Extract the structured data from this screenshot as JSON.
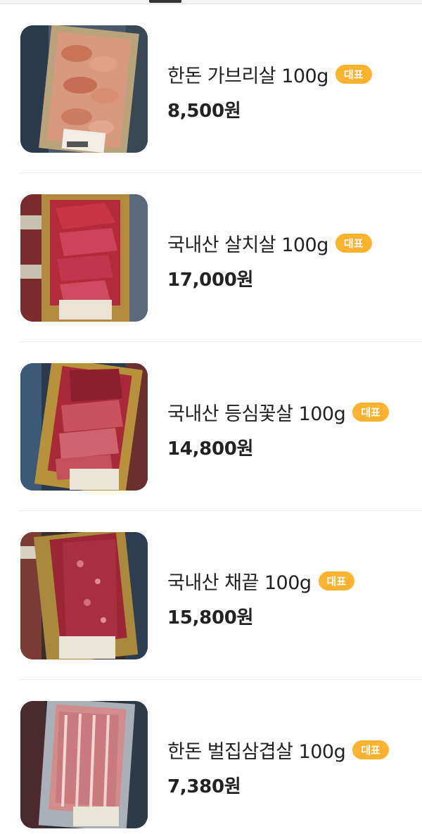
{
  "menu": {
    "items": [
      {
        "name": "한돈 가브리살 100g",
        "badge": "대표",
        "price": "8,500원",
        "image": "pork-jowl-tray-photo"
      },
      {
        "name": "국내산 살치살 100g",
        "badge": "대표",
        "price": "17,000원",
        "image": "beef-chuck-flap-tray-photo"
      },
      {
        "name": "국내산 등심꽃살 100g",
        "badge": "대표",
        "price": "14,800원",
        "image": "beef-sirloin-tray-photo"
      },
      {
        "name": "국내산 채끝 100g",
        "badge": "대표",
        "price": "15,800원",
        "image": "beef-striploin-tray-photo"
      },
      {
        "name": "한돈 벌집삼겹살 100g",
        "badge": "대표",
        "price": "7,380원",
        "image": "honeycomb-pork-belly-tray-photo"
      }
    ]
  },
  "colors": {
    "badge": "#ffb230",
    "text": "#222222",
    "divider": "#ececec"
  }
}
